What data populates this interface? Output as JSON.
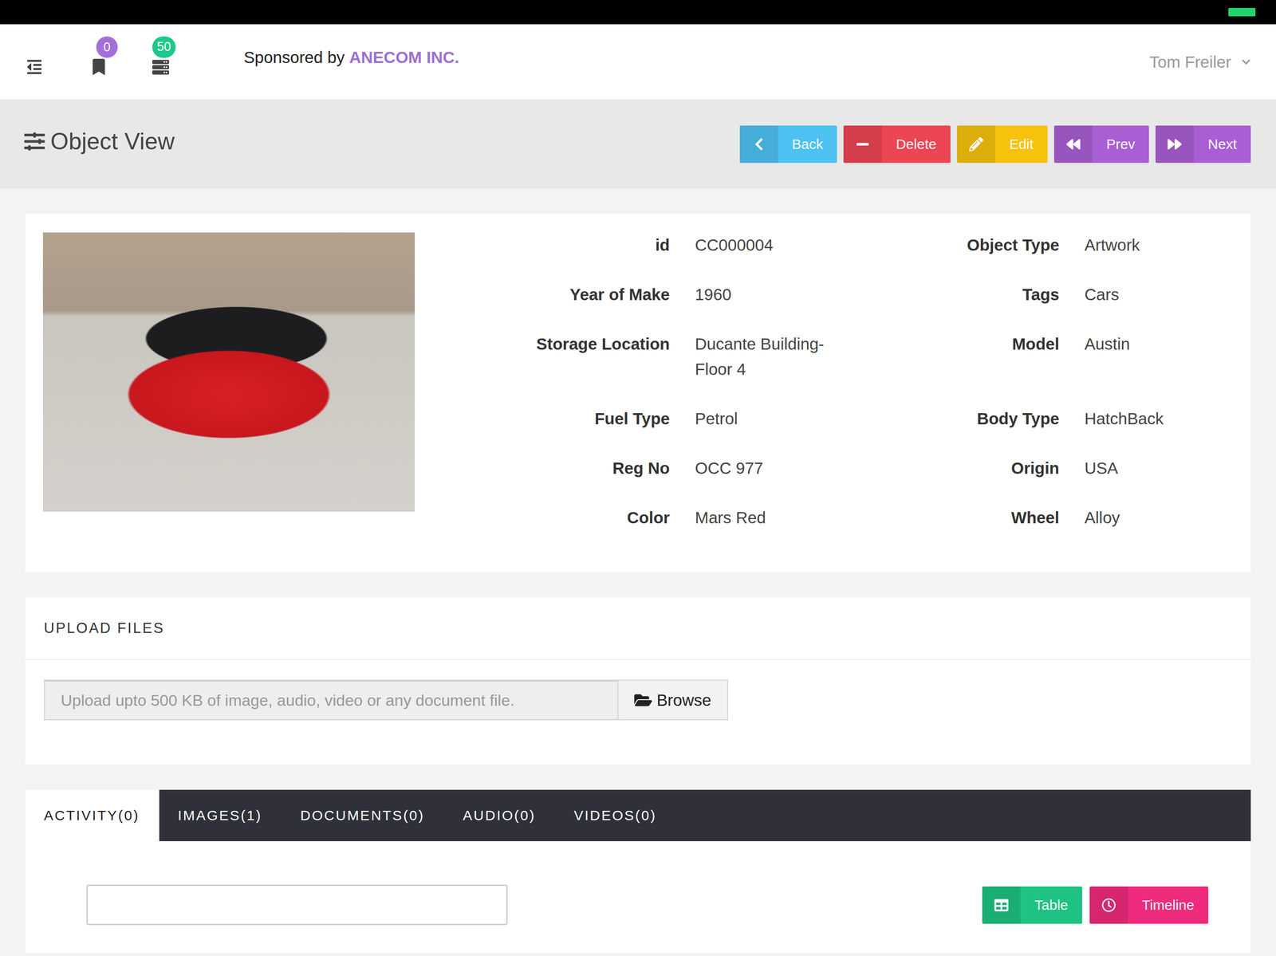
{
  "header": {
    "bookmarks_badge": "0",
    "list_badge": "50",
    "sponsor_prefix": "Sponsored by",
    "sponsor_name": "ANECOM INC.",
    "user": "Tom Freiler"
  },
  "page": {
    "title": "Object View"
  },
  "actions": [
    {
      "label": "Back",
      "kind": "back",
      "color": "#4cc1f2"
    },
    {
      "label": "Delete",
      "kind": "delete",
      "color": "#ec4553"
    },
    {
      "label": "Edit",
      "kind": "edit",
      "color": "#f7c20c"
    },
    {
      "label": "Prev",
      "kind": "prev",
      "color": "#a95fd3"
    },
    {
      "label": "Next",
      "kind": "next",
      "color": "#a95fd3"
    }
  ],
  "fields": [
    {
      "label": "id",
      "value": "CC000004"
    },
    {
      "label": "Object Type",
      "value": "Artwork"
    },
    {
      "label": "Year of Make",
      "value": "1960"
    },
    {
      "label": "Tags",
      "value": "Cars"
    },
    {
      "label": "Storage Location",
      "value": "Ducante Building-Floor 4"
    },
    {
      "label": "Model",
      "value": "Austin"
    },
    {
      "label": "Fuel Type",
      "value": "Petrol"
    },
    {
      "label": "Body Type",
      "value": "HatchBack"
    },
    {
      "label": "Reg No",
      "value": "OCC 977"
    },
    {
      "label": "Origin",
      "value": "USA"
    },
    {
      "label": "Color",
      "value": "Mars Red"
    },
    {
      "label": "Wheel",
      "value": "Alloy"
    }
  ],
  "upload": {
    "title": "UPLOAD FILES",
    "placeholder": "Upload upto 500 KB of image, audio, video or any document file.",
    "button": "Browse"
  },
  "tabs": [
    {
      "label": "ACTIVITY(0)",
      "selected": true
    },
    {
      "label": "IMAGES(1)",
      "selected": false
    },
    {
      "label": "DOCUMENTS(0)",
      "selected": false
    },
    {
      "label": "AUDIO(0)",
      "selected": false
    },
    {
      "label": "VIDEOS(0)",
      "selected": false
    }
  ],
  "views": [
    {
      "label": "Table",
      "kind": "table",
      "color": "#1ec283"
    },
    {
      "label": "Timeline",
      "kind": "timeline",
      "color": "#ee2b7c"
    }
  ]
}
